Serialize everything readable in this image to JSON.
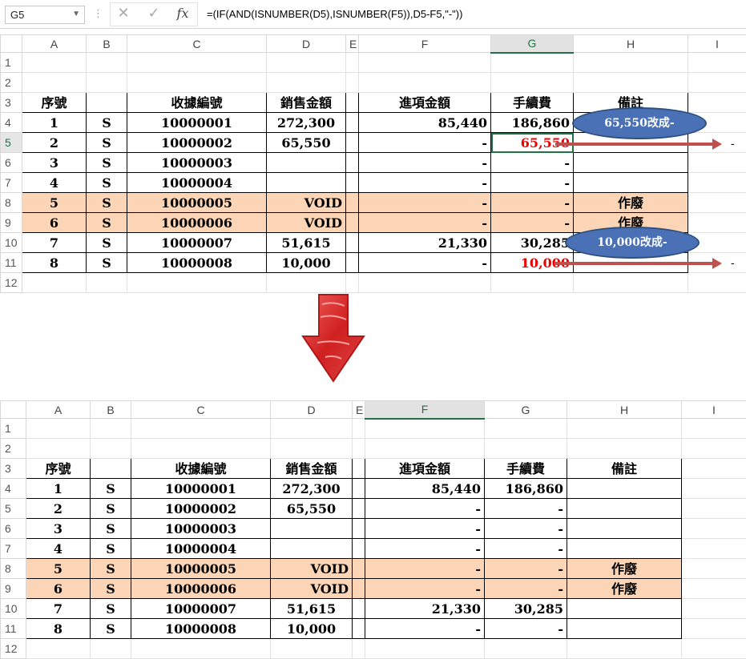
{
  "formula_bar": {
    "name_box": "G5",
    "fx": "fx",
    "formula": "=(IF(AND(ISNUMBER(D5),ISNUMBER(F5)),D5-F5,\"-\"))",
    "cancel": "✕",
    "enter": "✓"
  },
  "columns": [
    "A",
    "B",
    "C",
    "D",
    "E",
    "F",
    "G",
    "H",
    "I"
  ],
  "header_row": {
    "no": "序號",
    "receipt": "收據編號",
    "sales": "銷售金額",
    "input": "進項金額",
    "fee": "手續費",
    "note": "備註"
  },
  "top": {
    "rows": [
      {
        "n": "1",
        "no": "1",
        "s": "S",
        "receipt": "10000001",
        "sales": "272,300",
        "input": "85,440",
        "fee": "186,860",
        "note": ""
      },
      {
        "n": "2",
        "no": "2",
        "s": "S",
        "receipt": "10000002",
        "sales": "65,550",
        "input": "-",
        "fee": "65,550",
        "note": ""
      },
      {
        "n": "3",
        "no": "3",
        "s": "S",
        "receipt": "10000003",
        "sales": "",
        "input": "-",
        "fee": "-",
        "note": ""
      },
      {
        "n": "4",
        "no": "4",
        "s": "S",
        "receipt": "10000004",
        "sales": "",
        "input": "-",
        "fee": "-",
        "note": ""
      },
      {
        "n": "5",
        "no": "5",
        "s": "S",
        "receipt": "10000005",
        "sales": "VOID",
        "input": "-",
        "fee": "-",
        "note": "作廢"
      },
      {
        "n": "6",
        "no": "6",
        "s": "S",
        "receipt": "10000006",
        "sales": "VOID",
        "input": "-",
        "fee": "-",
        "note": "作廢"
      },
      {
        "n": "7",
        "no": "7",
        "s": "S",
        "receipt": "10000007",
        "sales": "51,615",
        "input": "21,330",
        "fee": "30,285",
        "note": ""
      },
      {
        "n": "8",
        "no": "8",
        "s": "S",
        "receipt": "10000008",
        "sales": "10,000",
        "input": "-",
        "fee": "10,000",
        "note": ""
      }
    ]
  },
  "bottom": {
    "rows": [
      {
        "no": "1",
        "s": "S",
        "receipt": "10000001",
        "sales": "272,300",
        "input": "85,440",
        "fee": "186,860",
        "note": ""
      },
      {
        "no": "2",
        "s": "S",
        "receipt": "10000002",
        "sales": "65,550",
        "input": "-",
        "fee": "-",
        "note": ""
      },
      {
        "no": "3",
        "s": "S",
        "receipt": "10000003",
        "sales": "",
        "input": "-",
        "fee": "-",
        "note": ""
      },
      {
        "no": "4",
        "s": "S",
        "receipt": "10000004",
        "sales": "",
        "input": "-",
        "fee": "-",
        "note": ""
      },
      {
        "no": "5",
        "s": "S",
        "receipt": "10000005",
        "sales": "VOID",
        "input": "-",
        "fee": "-",
        "note": "作廢"
      },
      {
        "no": "6",
        "s": "S",
        "receipt": "10000006",
        "sales": "VOID",
        "input": "-",
        "fee": "-",
        "note": "作廢"
      },
      {
        "no": "7",
        "s": "S",
        "receipt": "10000007",
        "sales": "51,615",
        "input": "21,330",
        "fee": "30,285",
        "note": ""
      },
      {
        "no": "8",
        "s": "S",
        "receipt": "10000008",
        "sales": "10,000",
        "input": "-",
        "fee": "-",
        "note": ""
      }
    ]
  },
  "row_numbers": [
    "1",
    "2",
    "3",
    "4",
    "5",
    "6",
    "7",
    "8",
    "9",
    "10",
    "11",
    "12"
  ],
  "callouts": {
    "first": "65,550改成-",
    "second": "10,000改成-",
    "dash": "-"
  },
  "colors": {
    "accent": "#217346",
    "peach": "#fbd5b5",
    "callout": "#4a71b5",
    "arrow": "#c0504d",
    "red": "#e00000"
  },
  "icons": {
    "arrow": "down-arrow-icon"
  }
}
